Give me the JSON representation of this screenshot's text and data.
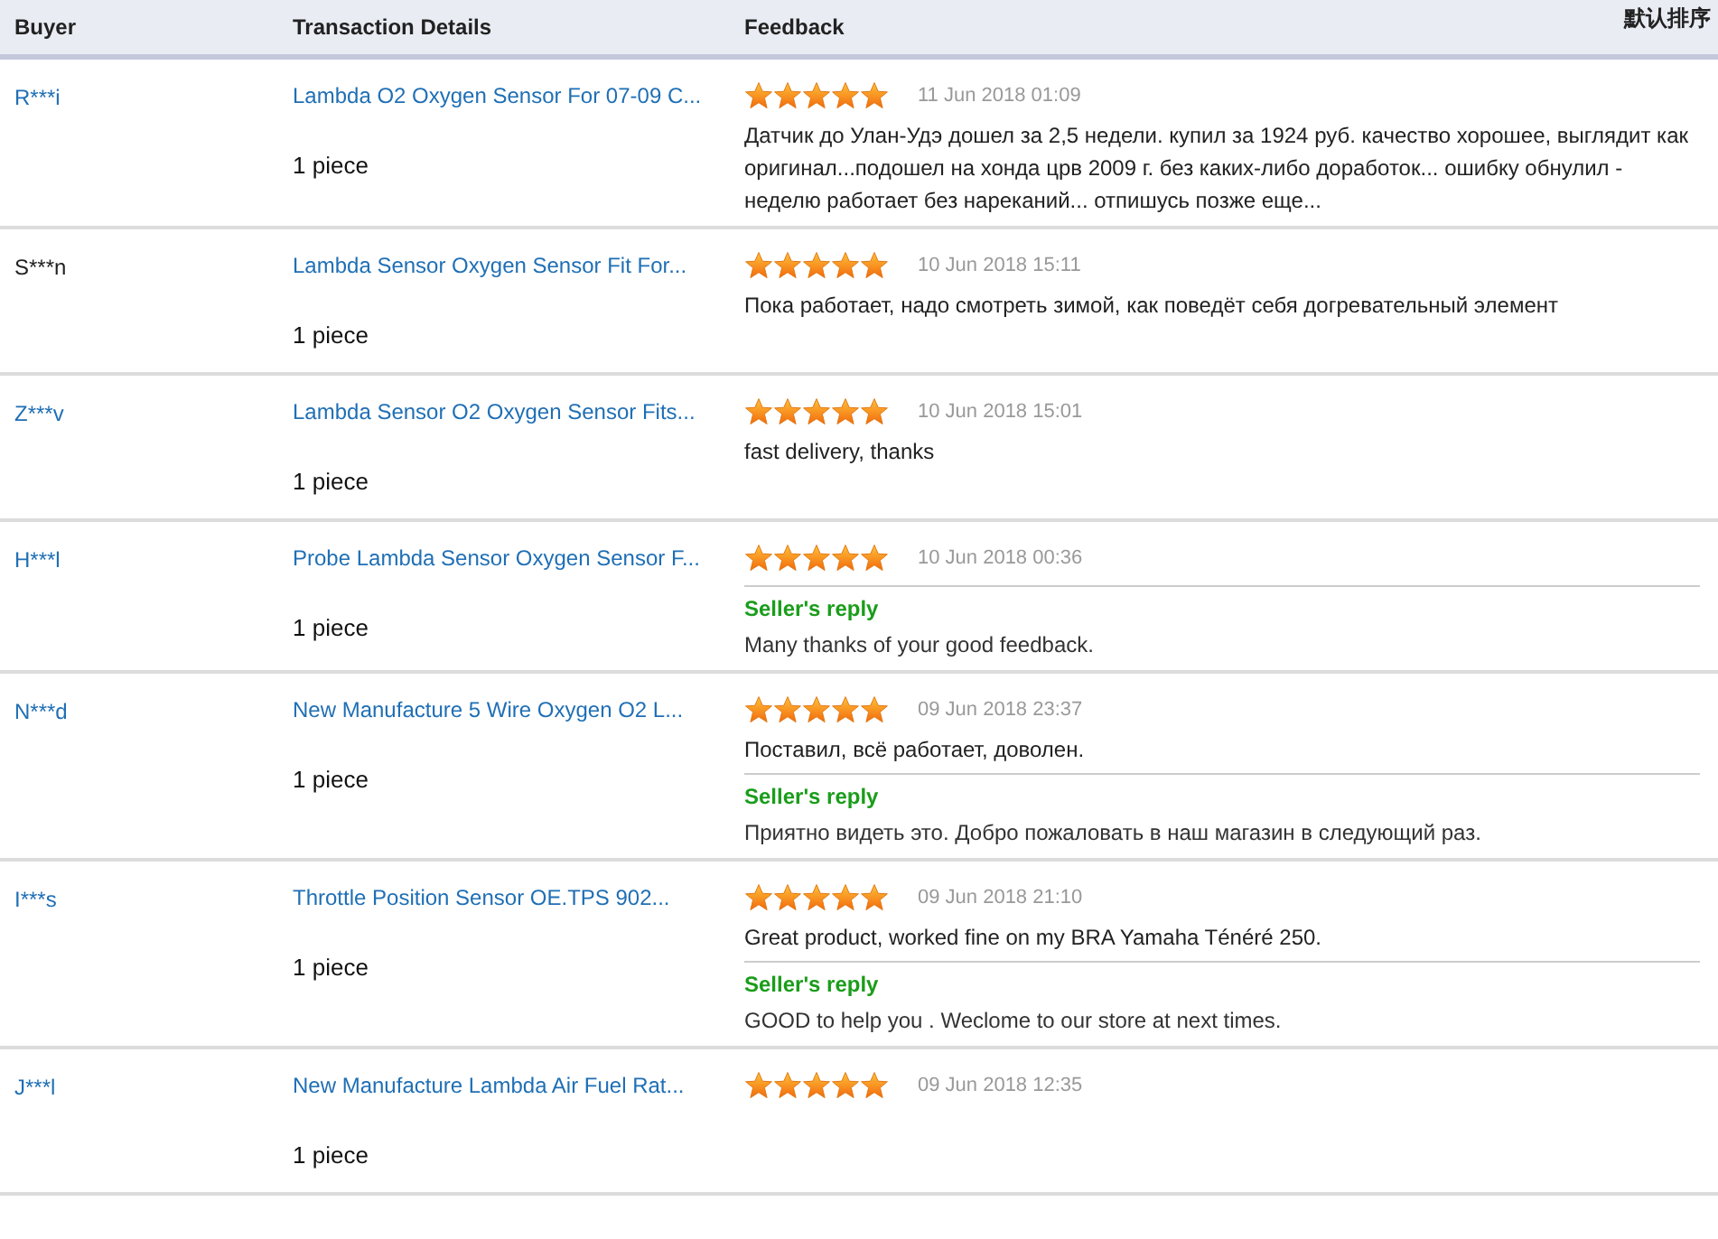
{
  "header": {
    "columns": [
      "Buyer",
      "Transaction Details",
      "Feedback"
    ],
    "sort_label": "默认排序"
  },
  "rows": [
    {
      "buyer": "R***i",
      "buyer_linked": true,
      "product": "Lambda O2 Oxygen Sensor For 07-09 C...",
      "quantity": "1 piece",
      "stars": 5,
      "date": "11 Jun 2018 01:09",
      "comment": "Датчик до Улан-Удэ дошел за 2,5 недели. купил за 1924 руб. качество хорошее, выглядит как оригинал...подошел на хонда црв 2009 г. без каких-либо доработок... ошибку обнулил - неделю работает без нареканий... отпишусь позже еще..."
    },
    {
      "buyer": "S***n",
      "buyer_linked": false,
      "product": "Lambda Sensor Oxygen Sensor Fit For...",
      "quantity": "1 piece",
      "stars": 5,
      "date": "10 Jun 2018 15:11",
      "comment": "Пока работает, надо смотреть зимой, как поведёт себя догревательный элемент"
    },
    {
      "buyer": "Z***v",
      "buyer_linked": true,
      "product": "Lambda Sensor O2 Oxygen Sensor Fits...",
      "quantity": "1 piece",
      "stars": 5,
      "date": "10 Jun 2018 15:01",
      "comment": "fast delivery, thanks"
    },
    {
      "buyer": "H***l",
      "buyer_linked": true,
      "product": "Probe Lambda Sensor Oxygen Sensor F...",
      "quantity": "1 piece",
      "stars": 5,
      "date": "10 Jun 2018 00:36",
      "reply": {
        "label": "Seller's reply",
        "text": "Many thanks of your good feedback."
      }
    },
    {
      "buyer": "N***d",
      "buyer_linked": true,
      "product": "New Manufacture 5 Wire Oxygen O2 L...",
      "quantity": "1 piece",
      "stars": 5,
      "date": "09 Jun 2018 23:37",
      "comment": "Поставил, всё работает, доволен.",
      "reply": {
        "label": "Seller's reply",
        "text": "Приятно видеть это. Добро пожаловать в наш магазин в следующий раз."
      }
    },
    {
      "buyer": "I***s",
      "buyer_linked": true,
      "product": "Throttle Position Sensor OE.TPS 902...",
      "quantity": "1 piece",
      "stars": 5,
      "date": "09 Jun 2018 21:10",
      "comment": "Great product, worked fine on my BRA Yamaha Ténéré 250.",
      "reply": {
        "label": "Seller's reply",
        "text": "GOOD to help you . Weclome to our store at next times."
      }
    },
    {
      "buyer": "J***l",
      "buyer_linked": true,
      "product": "New Manufacture Lambda Air Fuel Rat...",
      "quantity": "1 piece",
      "stars": 5,
      "date": "09 Jun 2018 12:35"
    }
  ]
}
